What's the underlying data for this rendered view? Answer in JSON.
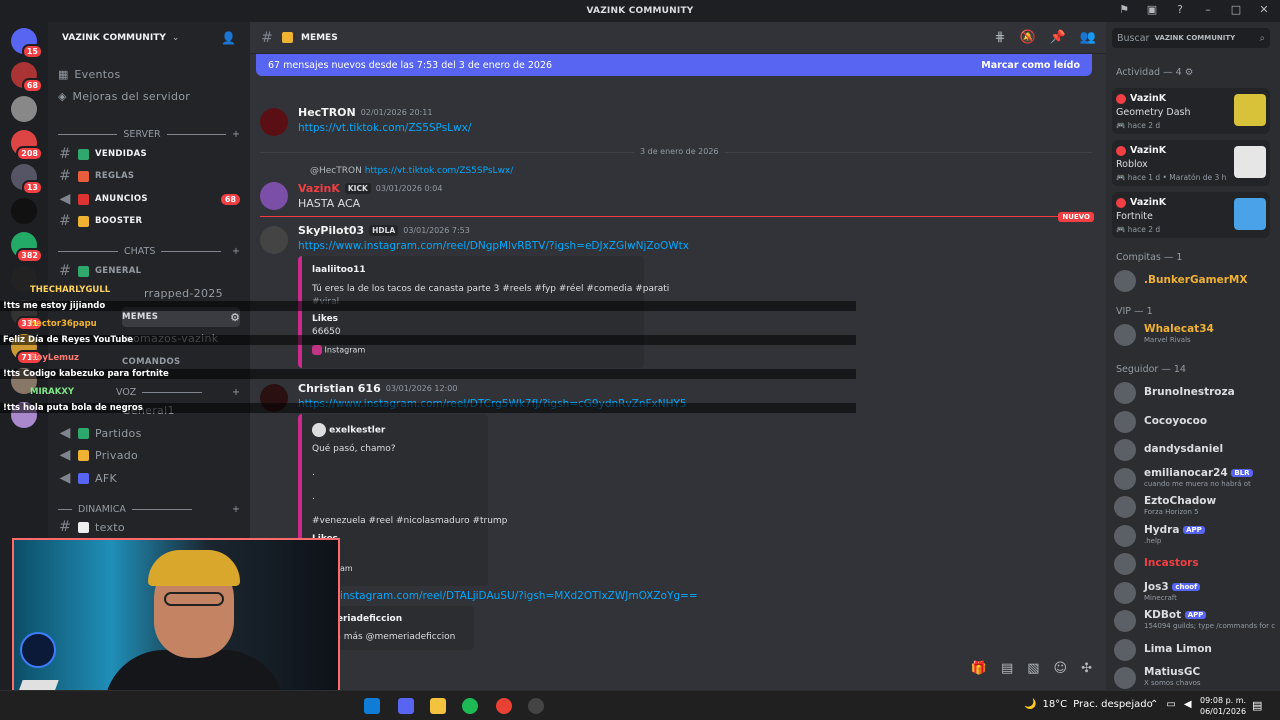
{
  "window": {
    "title": "VAZINK COMMUNITY"
  },
  "rail": {
    "servers": [
      {
        "name": "dm-home",
        "badge": "15",
        "color": "#5865f2"
      },
      {
        "name": "server-1",
        "badge": "68",
        "color": "#a33"
      },
      {
        "name": "server-2",
        "badge": "",
        "color": "#888"
      },
      {
        "name": "server-3",
        "badge": "208",
        "color": "#d44"
      },
      {
        "name": "server-4",
        "badge": "13",
        "color": "#556"
      },
      {
        "name": "server-5",
        "badge": "",
        "color": "#111"
      },
      {
        "name": "server-6",
        "badge": "382",
        "color": "#2a6"
      },
      {
        "name": "server-7",
        "badge": "",
        "color": "#222"
      },
      {
        "name": "server-8",
        "badge": "331",
        "color": "#333"
      },
      {
        "name": "server-9",
        "badge": "711",
        "color": "#c93"
      },
      {
        "name": "server-10",
        "badge": "",
        "color": "#876"
      },
      {
        "name": "server-11",
        "badge": "",
        "color": "#a8c"
      }
    ]
  },
  "sidebar": {
    "server_name": "VAZINK COMMUNITY",
    "eventos": "Eventos",
    "mejoras": "Mejoras del servidor",
    "cat_server": "SERVER",
    "ch_ventas": "VENDIDAS",
    "ch_reglas": "REGLAS",
    "ch_anuncios": "ANUNCIOS",
    "ch_anuncios_badge": "68",
    "ch_booster": "BOOSTER",
    "cat_chats": "CHATS",
    "ch_general": "GENERAL",
    "ch_wrapped": "rrapped-2025",
    "ch_memes": "MEMES",
    "ch_momazos": "momazos-vazink",
    "ch_comandos": "COMANDOS",
    "cat_voz": "VOZ",
    "ch_general1": "General1",
    "ch_partidos": "Partidos",
    "ch_privado": "Privado",
    "ch_afk": "AFK",
    "cat_dinamica": "DINAMICA",
    "ch_texto": "texto"
  },
  "chat_overlay": [
    {
      "user": "THECHARLYGULL",
      "msg": "!tts me estoy jijiando"
    },
    {
      "user": "hector36papu",
      "msg": "Feliz Día de Reyes YouTube"
    },
    {
      "user": "RoyLemuz",
      "msg": "!tts Codigo kabezuko para fortnite"
    },
    {
      "user": "MIRAKXY",
      "msg": "!tts hola puta bola de negros"
    }
  ],
  "main": {
    "channel": "MEMES",
    "new_messages": "67 mensajes nuevos desde las 7:53 del 3 de enero de 2026",
    "mark_read": "Marcar como leído",
    "date_divider": "3 de enero de 2026",
    "nuevo": "NUEVO",
    "messages": [
      {
        "author": "HecTRON",
        "time": "02/01/2026 20:11",
        "link": "https://vt.tiktok.com/ZS5SPsLwx/"
      },
      {
        "reply_to": "@HecTRON",
        "reply_link": "https://vt.tiktok.com/ZS5SPsLwx/",
        "author": "VazinK",
        "tag": "KICK",
        "time": "03/01/2026 0:04",
        "text": "HASTA ACA"
      },
      {
        "author": "SkyPilot03",
        "tag": "HDLA",
        "time": "03/01/2026 7:53",
        "link": "https://www.instagram.com/reel/DNgpMlvRBTV/?igsh=eDJxZGlwNjZoOWtx",
        "embed": {
          "user": "laaliitoo11",
          "desc": "Tú eres la de los tacos de canasta parte 3 #reels #fyp #réel #comedia #parati",
          "desc2": "#viral",
          "likes_label": "Likes",
          "likes": "66650",
          "footer": "Instagram"
        }
      },
      {
        "author": "Christian 616",
        "time": "03/01/2026 12:00",
        "link": "https://www.instagram.com/reel/DTCrg5Wk7fJ/?igsh=cG9ydnRvZnFxNHY5",
        "embed": {
          "user": "exelkestler",
          "desc": "Qué pasó, chamo?",
          "dot1": ".",
          "dot2": ".",
          "tags": "#venezuela #reel #nicolasmaduro #trump",
          "likes_label": "Likes",
          "footer": "Instagram"
        }
      },
      {
        "link": "instagram.com/reel/DTALjiDAuSU/?igsh=MXd2OTlxZWJmOXZoYg==",
        "embed": {
          "user": "memeriadeficcion",
          "desc": "e para más @memeriadeficcion"
        }
      }
    ]
  },
  "members": {
    "search_placeholder": "Buscar",
    "search_server": "VAZINK COMMUNITY",
    "activity_header": "Actividad — 4",
    "activities": [
      {
        "user": "VazinK",
        "game": "Geometry Dash",
        "sub": "hace 2 d",
        "thumb": "#d8c23a"
      },
      {
        "user": "VazinK",
        "game": "Roblox",
        "sub": "hace 1 d",
        "sub2": "Maratón de 3 h",
        "thumb": "#e6e6e6"
      },
      {
        "user": "VazinK",
        "game": "Fortnite",
        "sub": "hace 2 d",
        "thumb": "#4aa3e8"
      }
    ],
    "role_compitas": "Compitas — 1",
    "compitas": [
      {
        "name": ".BunkerGamerMX",
        "color": "#f0b232"
      }
    ],
    "role_vip": "VIP — 1",
    "vip": [
      {
        "name": "Whalecat34",
        "status": "Marvel Rivals",
        "color": "#f0b232"
      }
    ],
    "role_seguidor": "Seguidor — 14",
    "seguidores": [
      {
        "name": "BrunoInestroza",
        "status": ""
      },
      {
        "name": "Cocoyocoo",
        "status": ""
      },
      {
        "name": "dandysdaniel",
        "status": ""
      },
      {
        "name": "emilianocar24",
        "tag": "BLR",
        "status": "cuando me muera no habrá ot"
      },
      {
        "name": "EztoChadow",
        "status": "Forza Horizon 5"
      },
      {
        "name": "Hydra",
        "tag": "APP",
        "status": ".help"
      },
      {
        "name": "Incastors",
        "status": "",
        "color": "#f23f43"
      },
      {
        "name": "Jos3",
        "tag": "choof",
        "status": "Minecraft"
      },
      {
        "name": "KDBot",
        "tag": "APP",
        "status": "154094 guilds; type /commands for c"
      },
      {
        "name": "Lima Limon",
        "status": ""
      },
      {
        "name": "MatiusGC",
        "status": "X somos chavos"
      }
    ]
  },
  "taskbar": {
    "temperature": "18°C",
    "weather": "Prac. despejado",
    "time": "09:08 p. m.",
    "date": "06/01/2026"
  }
}
